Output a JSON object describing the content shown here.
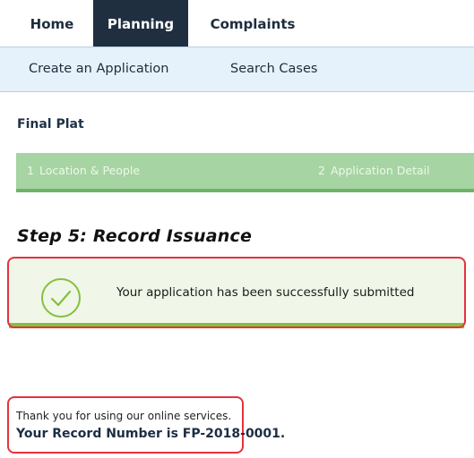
{
  "nav": {
    "tabs": [
      {
        "label": "Home",
        "active": false
      },
      {
        "label": "Planning",
        "active": true
      },
      {
        "label": "Complaints",
        "active": false
      }
    ]
  },
  "subnav": {
    "items": [
      {
        "label": "Create an Application"
      },
      {
        "label": "Search Cases"
      }
    ]
  },
  "record_type": "Final Plat",
  "progress": {
    "steps": [
      {
        "number": "1",
        "label": "Location & People"
      },
      {
        "number": "2",
        "label": "Application Detail"
      }
    ]
  },
  "step_heading": "Step 5: Record Issuance",
  "success": {
    "message": "Your application has been successfully submitted"
  },
  "thanks": {
    "line1": "Thank you for using our online services.",
    "line2": "Your Record Number is FP-2018-0001."
  },
  "colors": {
    "nav_active": "#1f2f3f",
    "subnav_bg": "#e6f2fb",
    "progress_bg": "#a6d4a2",
    "success_bg": "#f0f7e8",
    "success_accent": "#86bf3e",
    "highlight": "#e5323f"
  }
}
